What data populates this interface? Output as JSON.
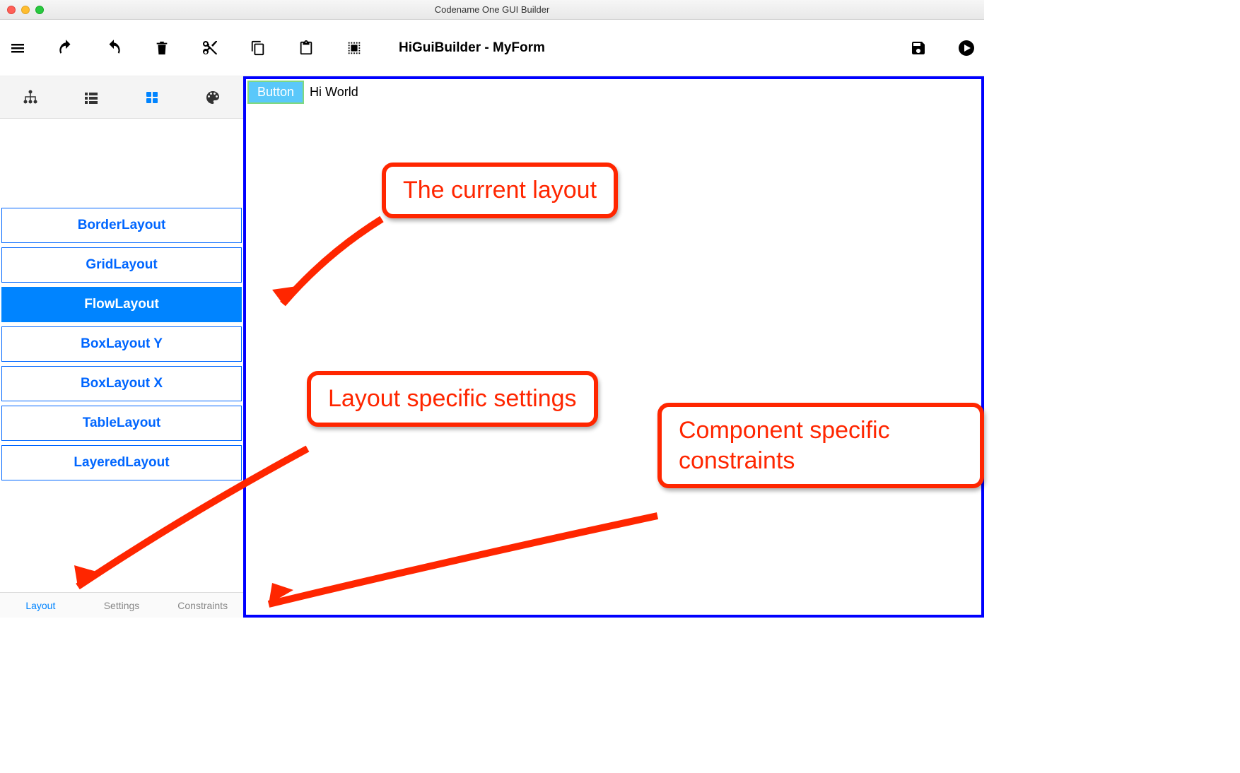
{
  "window": {
    "title": "Codename One GUI Builder"
  },
  "toolbar": {
    "document_title": "HiGuiBuilder - MyForm"
  },
  "sidebar": {
    "layouts": [
      {
        "label": "BorderLayout",
        "selected": false
      },
      {
        "label": "GridLayout",
        "selected": false
      },
      {
        "label": "FlowLayout",
        "selected": true
      },
      {
        "label": "BoxLayout Y",
        "selected": false
      },
      {
        "label": "BoxLayout X",
        "selected": false
      },
      {
        "label": "TableLayout",
        "selected": false
      },
      {
        "label": "LayeredLayout",
        "selected": false
      }
    ],
    "bottom_tabs": {
      "layout": "Layout",
      "settings": "Settings",
      "constraints": "Constraints"
    }
  },
  "canvas": {
    "button_label": "Button",
    "text_label": "Hi World"
  },
  "annotations": {
    "current_layout": "The current layout",
    "layout_settings": "Layout specific settings",
    "component_constraints": "Component specific constraints"
  }
}
